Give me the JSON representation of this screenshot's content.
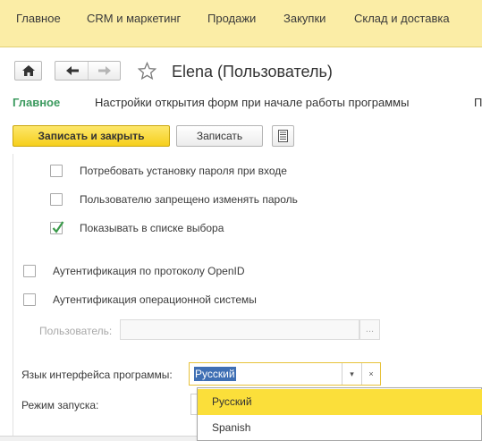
{
  "top_menu": {
    "items": [
      "Главное",
      "CRM и маркетинг",
      "Продажи",
      "Закупки",
      "Склад и доставка"
    ]
  },
  "header": {
    "title": "Elena (Пользователь)"
  },
  "form_tabs": {
    "items": [
      "Главное",
      "Настройки открытия форм при начале работы программы",
      "П"
    ]
  },
  "commands": {
    "save_close": "Записать и закрыть",
    "save": "Записать"
  },
  "checkboxes": [
    {
      "label": "Потребовать установку пароля при входе",
      "checked": false
    },
    {
      "label": "Пользователю запрещено изменять пароль",
      "checked": false
    },
    {
      "label": "Показывать в списке выбора",
      "checked": true
    },
    {
      "label": "Аутентификация по протоколу OpenID",
      "checked": false
    },
    {
      "label": "Аутентификация операционной системы",
      "checked": false
    }
  ],
  "os_user": {
    "label": "Пользователь:",
    "value": "",
    "select_label": "..."
  },
  "interface_language": {
    "label": "Язык интерфейса программы:",
    "value": "Русский",
    "dropdown_glyph": "▾",
    "clear_glyph": "×"
  },
  "launch_mode": {
    "label": "Режим запуска:"
  },
  "language_dropdown": {
    "options": [
      "Русский",
      "Spanish"
    ],
    "selected": "Русский"
  },
  "colors": {
    "menu_bg": "#fbeda6",
    "accent_yellow": "#f6cf1c",
    "active_tab_green": "#3b9a5e",
    "selection_blue": "#3f6fb4",
    "check_green": "#3a9a4a"
  }
}
